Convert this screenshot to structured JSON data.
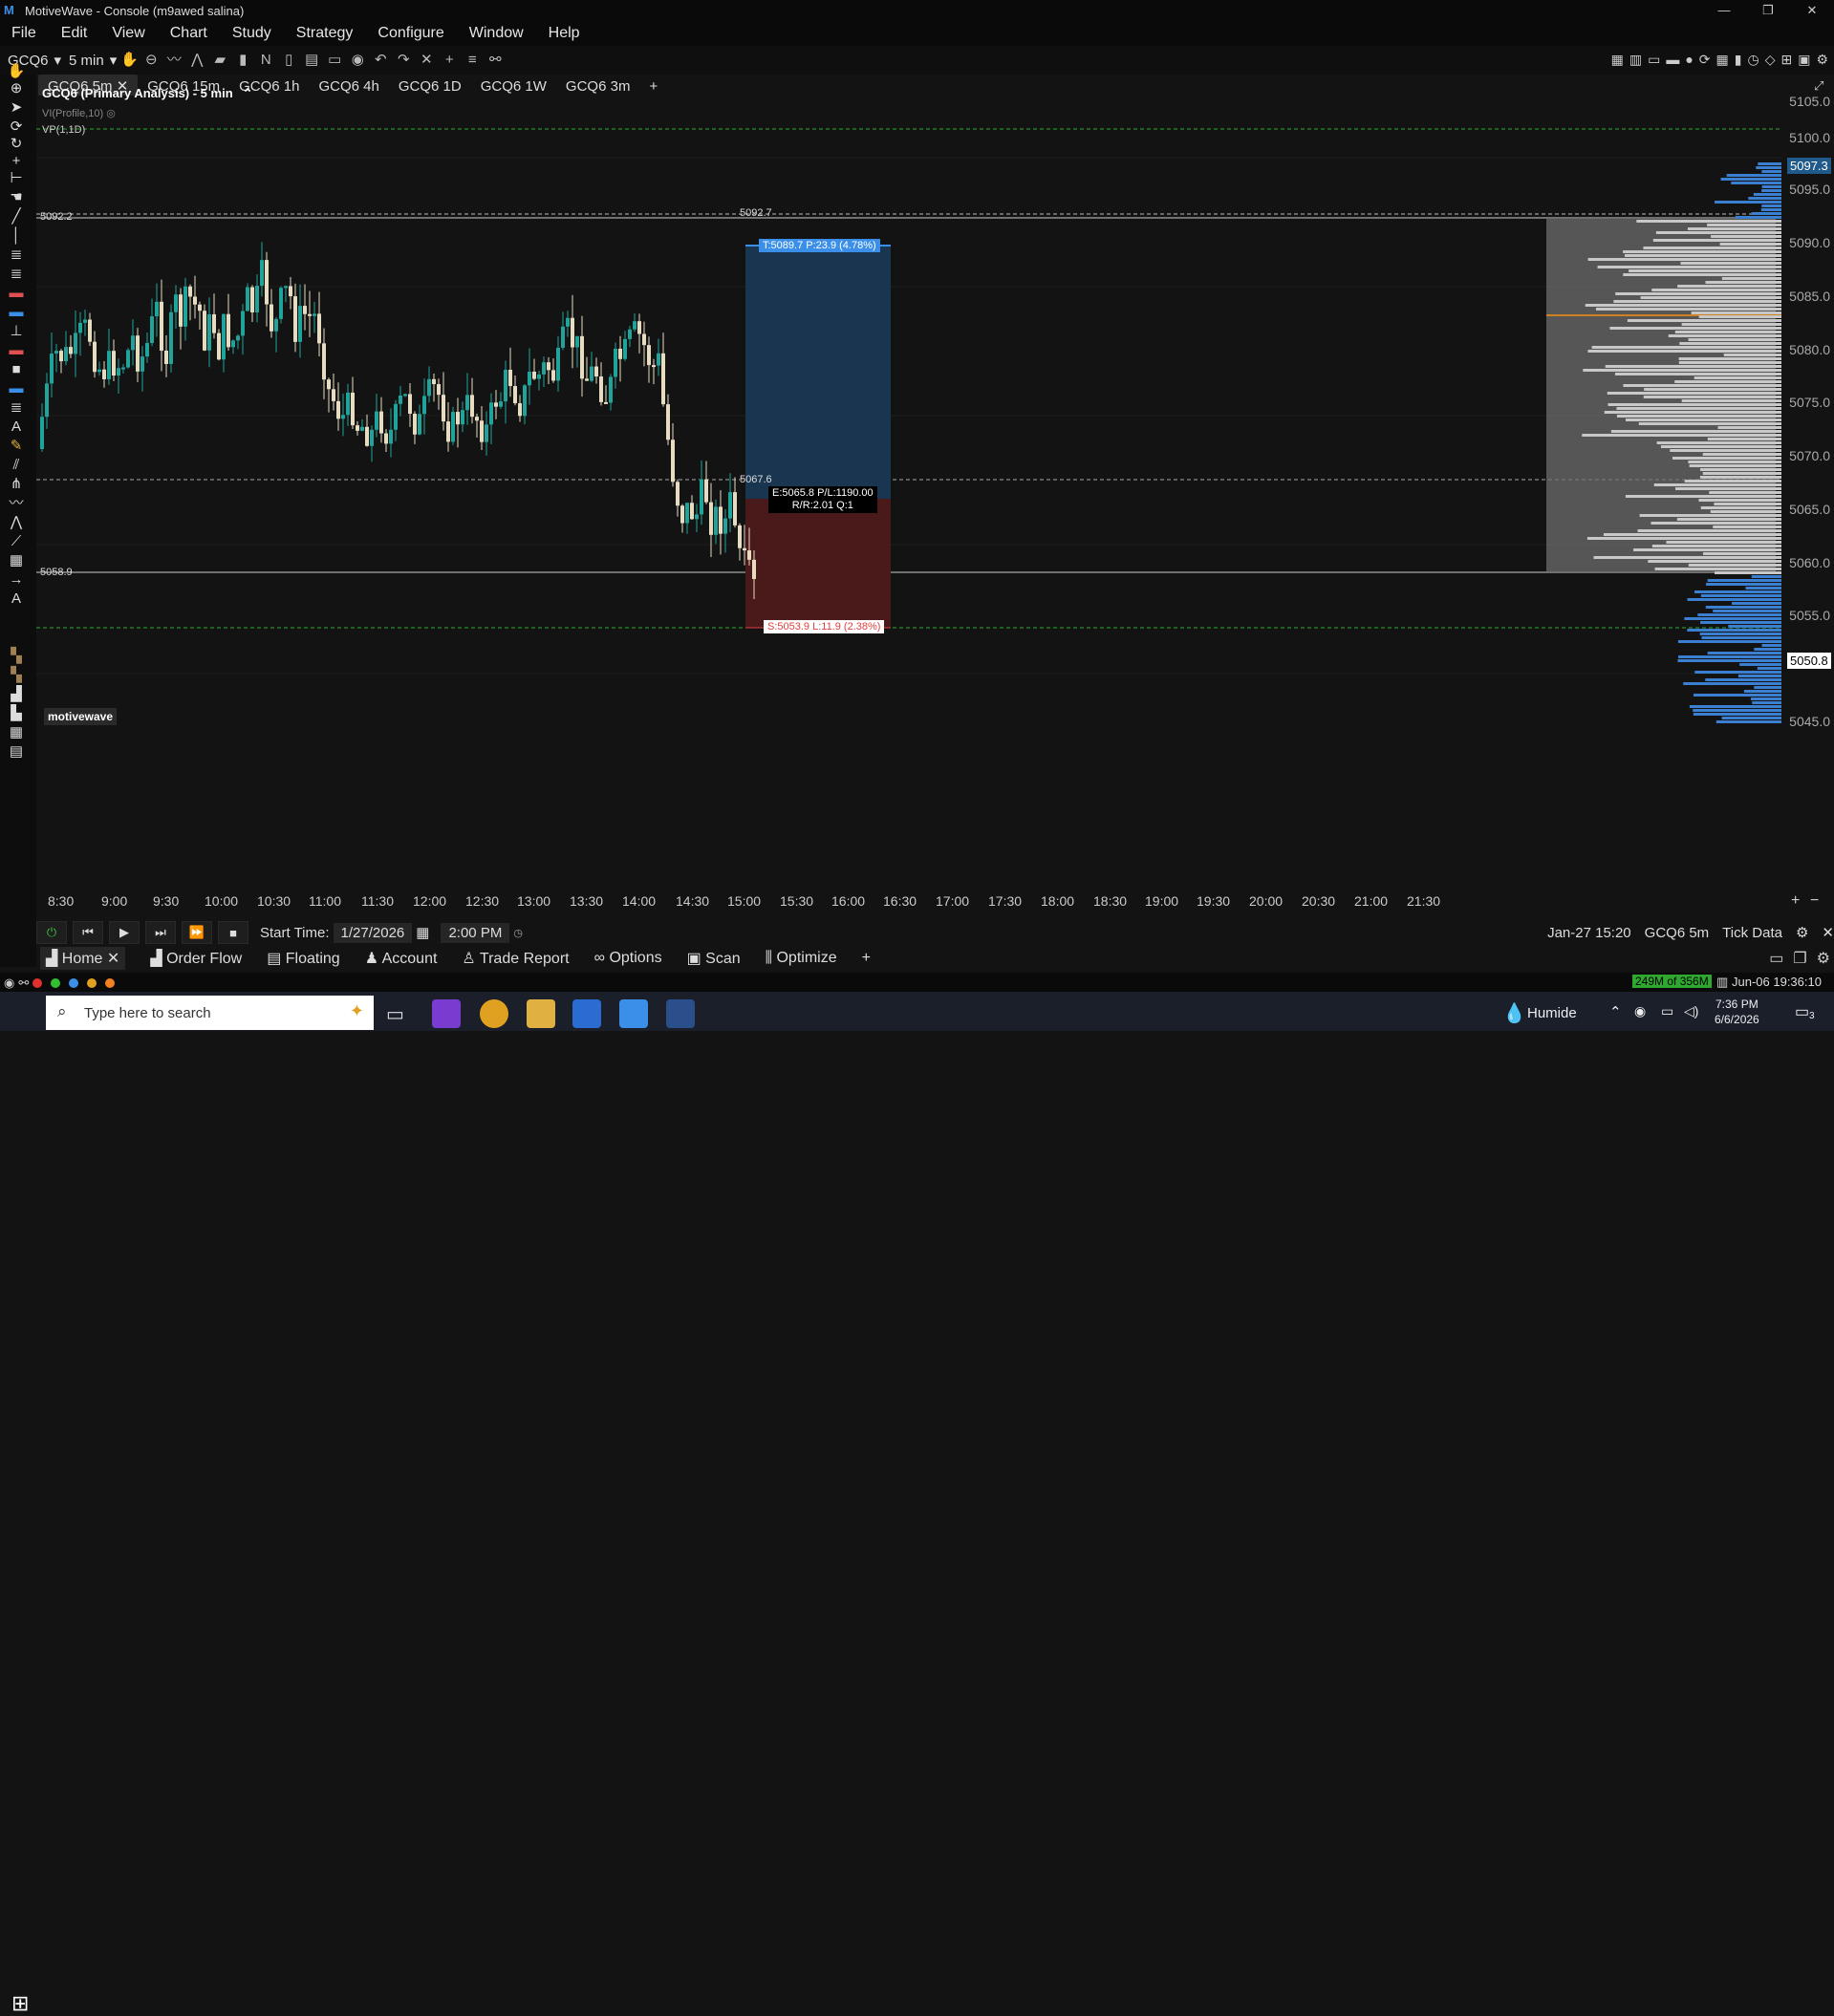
{
  "window": {
    "title": "MotiveWave - Console (m9awed salina)",
    "buttons": [
      "—",
      "❐",
      "✕"
    ]
  },
  "menu": [
    "File",
    "Edit",
    "View",
    "Chart",
    "Study",
    "Strategy",
    "Configure",
    "Window",
    "Help"
  ],
  "toolbar": {
    "symbol": "GCQ6",
    "interval": "5 min"
  },
  "chart_tabs": [
    {
      "label": "GCQ6 5m",
      "active": true
    },
    {
      "label": "GCQ6 15m"
    },
    {
      "label": "GCQ6 1h"
    },
    {
      "label": "GCQ6 4h"
    },
    {
      "label": "GCQ6 1D"
    },
    {
      "label": "GCQ6 1W"
    },
    {
      "label": "GCQ6 3m"
    }
  ],
  "chart": {
    "title": "GCQ6 (Primary Analysis) - 5 min",
    "study1": "VI(Profile,10)",
    "study2": "VP(1,1D)",
    "watermark": "motivewave",
    "line_high_left": "5092.2",
    "line_high_mid": "5092.7",
    "line_mid": "5067.6",
    "line_low": "5058.9",
    "target_label": "T:5089.7 P:23.9 (4.78%)",
    "entry_label1": "E:5065.8 P/L:1190.00",
    "entry_label2": "R/R:2.01 Q:1",
    "stop_label": "S:5053.9 L:11.9 (2.38%)",
    "price_tag_top": "5097.3",
    "price_tag_bottom": "5050.8"
  },
  "price_axis": [
    "5105.0",
    "5100.0",
    "5095.0",
    "5090.0",
    "5085.0",
    "5080.0",
    "5075.0",
    "5070.0",
    "5065.0",
    "5060.0",
    "5055.0",
    "5045.0"
  ],
  "time_axis": [
    "8:30",
    "9:00",
    "9:30",
    "10:00",
    "10:30",
    "11:00",
    "11:30",
    "12:00",
    "12:30",
    "13:00",
    "13:30",
    "14:00",
    "14:30",
    "15:00",
    "15:30",
    "16:00",
    "16:30",
    "17:00",
    "17:30",
    "18:00",
    "18:30",
    "19:00",
    "19:30",
    "20:00",
    "20:30",
    "21:00",
    "21:30"
  ],
  "playback": {
    "start_time_label": "Start Time:",
    "date": "1/27/2026",
    "time": "2:00 PM",
    "status_date": "Jan-27 15:20",
    "status_symbol": "GCQ6 5m",
    "status_data": "Tick Data"
  },
  "bottom_tabs": [
    "Home",
    "Order Flow",
    "Floating",
    "Account",
    "Trade Report",
    "Options",
    "Scan",
    "Optimize"
  ],
  "status": {
    "memory": "249M of 356M",
    "datetime": "Jun-06 19:36:10"
  },
  "taskbar": {
    "search_placeholder": "Type here to search",
    "weather": "Humide",
    "clock_time": "7:36 PM",
    "clock_date": "6/6/2026",
    "notifications": "3"
  }
}
